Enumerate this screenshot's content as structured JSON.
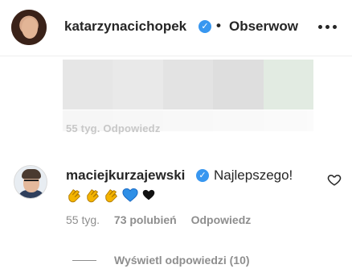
{
  "header": {
    "username": "katarzynacichopek",
    "separator": "•",
    "follow_label": "Obserwow",
    "verified_glyph": "✓"
  },
  "faded_comment": {
    "meta_text": "55 tyg.   Odpowiedz"
  },
  "comment": {
    "username": "maciejkurzajewski",
    "verified_glyph": "✓",
    "text": "Najlepszego!",
    "emojis": [
      "clapping-hands",
      "clapping-hands",
      "clapping-hands",
      "blue-heart",
      "black-heart"
    ],
    "time": "55 tyg.",
    "likes": "73 polubień",
    "reply_label": "Odpowiedz",
    "view_replies": "Wyświetl odpowiedzi (10)"
  },
  "colors": {
    "verified": "#3897f0",
    "muted": "#8e8e8e",
    "text": "#262626"
  }
}
